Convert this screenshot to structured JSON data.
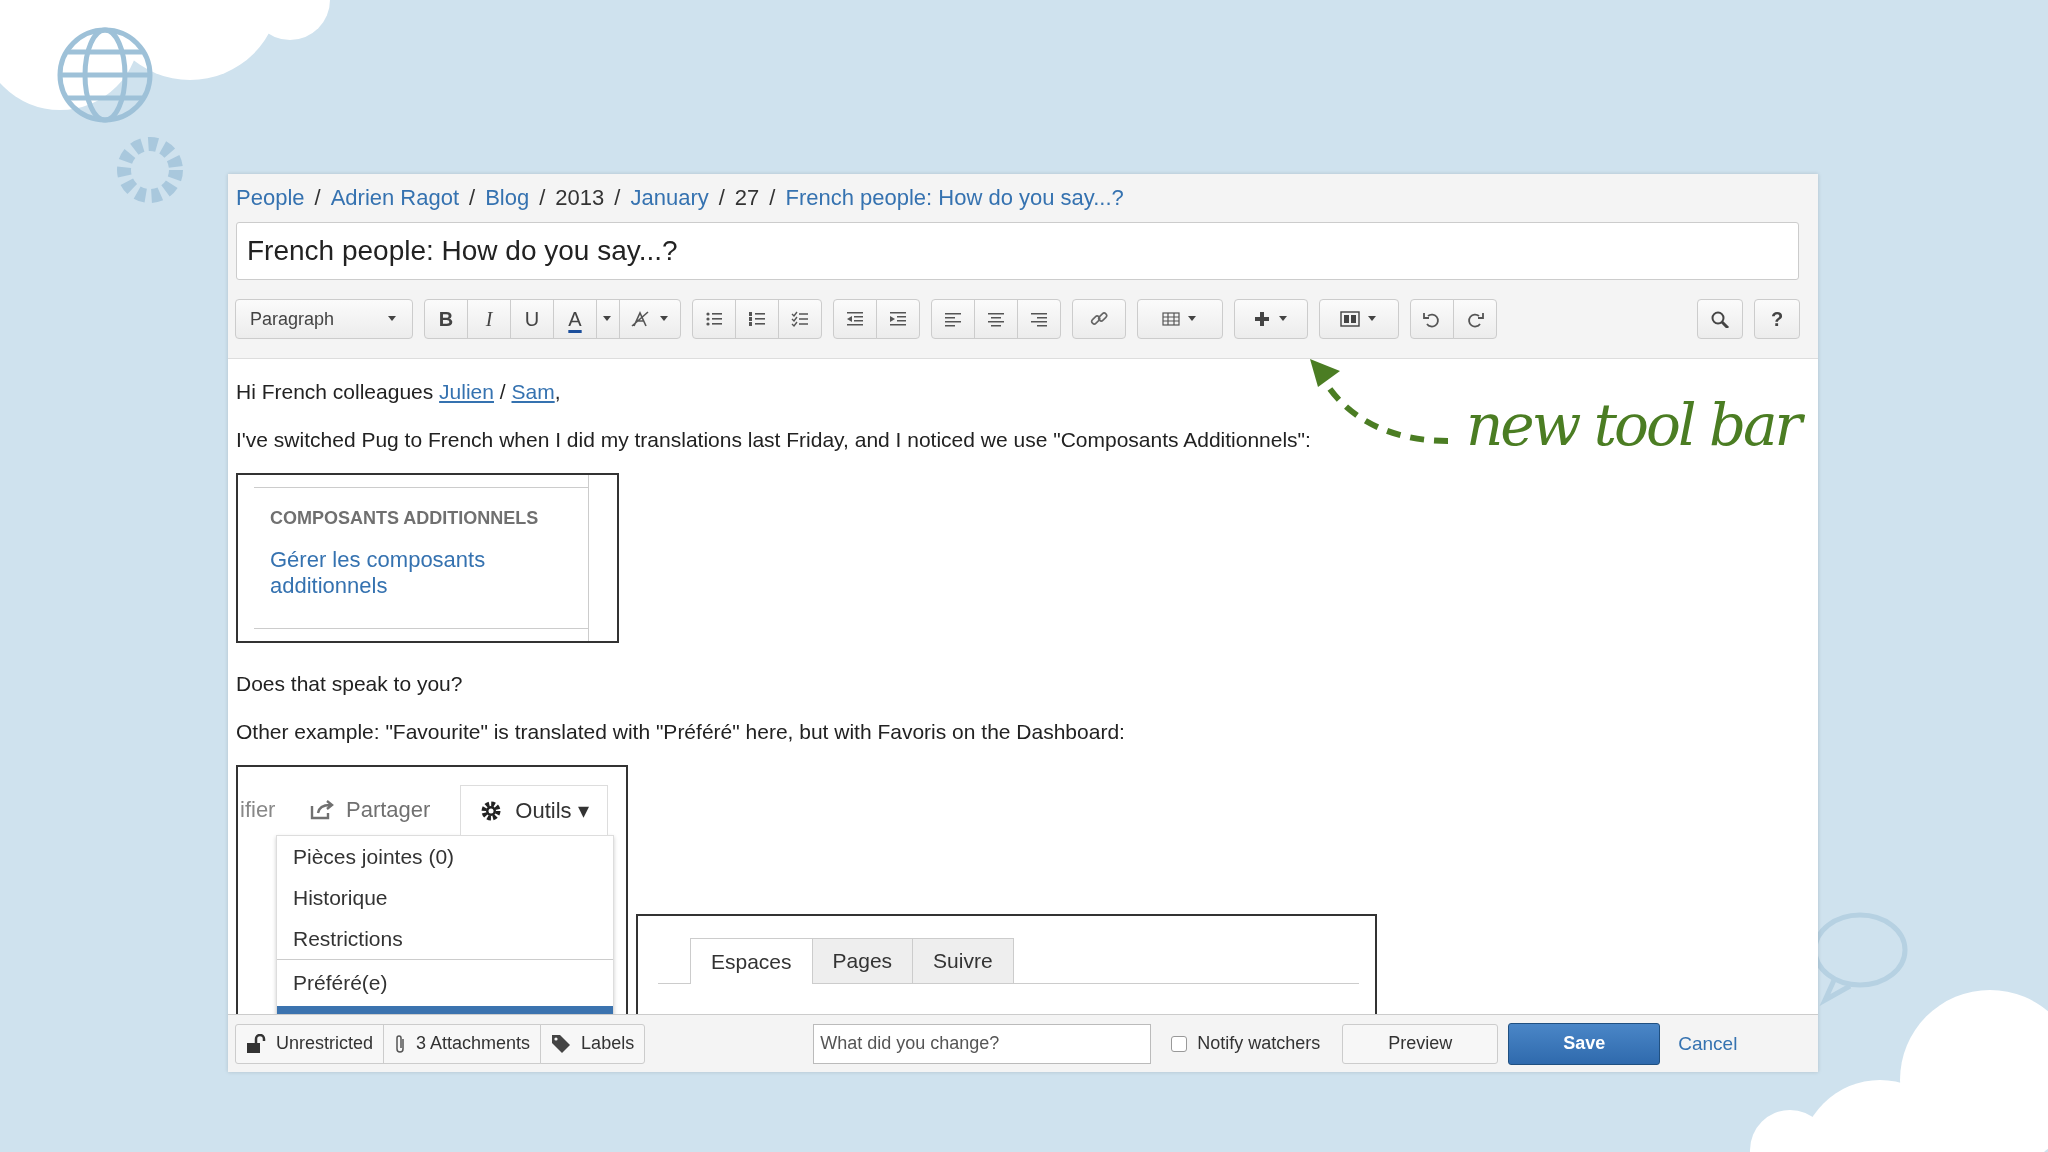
{
  "breadcrumb": [
    {
      "kind": "link",
      "label": "People"
    },
    {
      "kind": "separator",
      "label": "/"
    },
    {
      "kind": "link",
      "label": "Adrien Ragot"
    },
    {
      "kind": "separator",
      "label": "/"
    },
    {
      "kind": "link",
      "label": "Blog"
    },
    {
      "kind": "separator",
      "label": "/"
    },
    {
      "kind": "text",
      "label": "2013"
    },
    {
      "kind": "separator",
      "label": "/"
    },
    {
      "kind": "link",
      "label": "January"
    },
    {
      "kind": "separator",
      "label": "/"
    },
    {
      "kind": "text",
      "label": "27"
    },
    {
      "kind": "separator",
      "label": "/"
    },
    {
      "kind": "link",
      "label": "French people: How do you say...?"
    }
  ],
  "title_field": {
    "value": "French people: How do you say...?"
  },
  "toolbar": {
    "format": "Paragraph",
    "bold": "B",
    "italic": "I",
    "underline": "U",
    "text_color": "A",
    "help": "?"
  },
  "content": {
    "greeting": [
      {
        "kind": "text",
        "text": "Hi French colleagues "
      },
      {
        "kind": "link",
        "text": "Julien"
      },
      {
        "kind": "text",
        "text": " / "
      },
      {
        "kind": "link",
        "text": "Sam"
      },
      {
        "kind": "text",
        "text": ","
      }
    ],
    "paragraph_1": "I've switched Pug to French when I did my translations last Friday, and I noticed we use \"Composants Additionnels\":",
    "screenshot_1": {
      "heading": "COMPOSANTS ADDITIONNELS",
      "link": "Gérer les composants additionnels"
    },
    "paragraph_2": "Does that speak to you?",
    "paragraph_3": "Other example: \"Favourite\" is translated with \"Préféré\" here, but with Favoris on the Dashboard:",
    "screenshot_2": {
      "cut_label": "ifier",
      "share": "Partager",
      "tools": "Outils ▾",
      "menu": [
        {
          "label": "Pièces jointes (0)"
        },
        {
          "label": "Historique"
        },
        {
          "label": "Restrictions"
        },
        {
          "label": "Préféré(e)",
          "separator_before": true
        }
      ]
    },
    "screenshot_3": {
      "tabs": [
        {
          "label": "Espaces",
          "selected": true
        },
        {
          "label": "Pages",
          "selected": false
        },
        {
          "label": "Suivre",
          "selected": false
        }
      ]
    }
  },
  "bottom_bar": {
    "restrictions": "Unrestricted",
    "attachments": "3 Attachments",
    "labels": "Labels",
    "comment": {
      "placeholder": "What did you change?"
    },
    "notify": {
      "label": "Notify watchers",
      "checked": false
    },
    "preview": "Preview",
    "save": "Save",
    "cancel": "Cancel"
  },
  "annotation": {
    "text": "new tool bar"
  }
}
